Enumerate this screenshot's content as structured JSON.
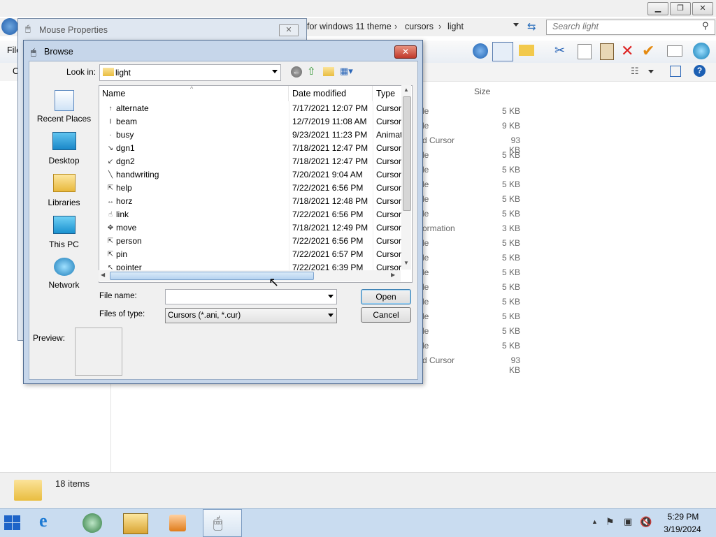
{
  "explorer": {
    "breadcrumb": [
      "for windows 11 theme",
      "cursors",
      "light"
    ],
    "search_placeholder": "Search light",
    "menu_first": "File",
    "cmd_first": "O",
    "size_header": "Size",
    "rows": [
      {
        "type": "le",
        "size": "5 KB"
      },
      {
        "type": "le",
        "size": "9 KB"
      },
      {
        "type": "d Cursor",
        "size": "93 KB"
      },
      {
        "type": "le",
        "size": "5 KB"
      },
      {
        "type": "le",
        "size": "5 KB"
      },
      {
        "type": "le",
        "size": "5 KB"
      },
      {
        "type": "le",
        "size": "5 KB"
      },
      {
        "type": "le",
        "size": "5 KB"
      },
      {
        "type": "ormation",
        "size": "3 KB"
      },
      {
        "type": "le",
        "size": "5 KB"
      },
      {
        "type": "le",
        "size": "5 KB"
      },
      {
        "type": "le",
        "size": "5 KB"
      },
      {
        "type": "le",
        "size": "5 KB"
      },
      {
        "type": "le",
        "size": "5 KB"
      },
      {
        "type": "le",
        "size": "5 KB"
      },
      {
        "type": "le",
        "size": "5 KB"
      },
      {
        "type": "le",
        "size": "5 KB"
      },
      {
        "type": "d Cursor",
        "size": "93 KB"
      }
    ],
    "status_items": "18 items"
  },
  "mouse_props": {
    "title": "Mouse Properties"
  },
  "browse": {
    "title": "Browse",
    "look_in_label": "Look in:",
    "look_in_value": "light",
    "places": [
      "Recent Places",
      "Desktop",
      "Libraries",
      "This PC",
      "Network"
    ],
    "columns": {
      "name": "Name",
      "date": "Date modified",
      "type": "Type"
    },
    "files": [
      {
        "name": "alternate",
        "date": "7/17/2021 12:07 PM",
        "type": "Cursor",
        "icon": "↑"
      },
      {
        "name": "beam",
        "date": "12/7/2019 11:08 AM",
        "type": "Cursor",
        "icon": "I"
      },
      {
        "name": "busy",
        "date": "9/23/2021 11:23 PM",
        "type": "Animated Cursor",
        "icon": "·"
      },
      {
        "name": "dgn1",
        "date": "7/18/2021 12:47 PM",
        "type": "Cursor",
        "icon": "↘"
      },
      {
        "name": "dgn2",
        "date": "7/18/2021 12:47 PM",
        "type": "Cursor",
        "icon": "↙"
      },
      {
        "name": "handwriting",
        "date": "7/20/2021 9:04 AM",
        "type": "Cursor",
        "icon": "╲"
      },
      {
        "name": "help",
        "date": "7/22/2021 6:56 PM",
        "type": "Cursor",
        "icon": "⇱"
      },
      {
        "name": "horz",
        "date": "7/18/2021 12:48 PM",
        "type": "Cursor",
        "icon": "↔"
      },
      {
        "name": "link",
        "date": "7/22/2021 6:56 PM",
        "type": "Cursor",
        "icon": "☝"
      },
      {
        "name": "move",
        "date": "7/18/2021 12:49 PM",
        "type": "Cursor",
        "icon": "✥"
      },
      {
        "name": "person",
        "date": "7/22/2021 6:56 PM",
        "type": "Cursor",
        "icon": "⇱"
      },
      {
        "name": "pin",
        "date": "7/22/2021 6:57 PM",
        "type": "Cursor",
        "icon": "⇱"
      },
      {
        "name": "pointer",
        "date": "7/22/2021 6:39 PM",
        "type": "Cursor",
        "icon": "↖"
      }
    ],
    "file_name_label": "File name:",
    "file_name_value": "",
    "files_of_type_label": "Files of type:",
    "files_of_type_value": "Cursors (*.ani, *.cur)",
    "open_label": "Open",
    "cancel_label": "Cancel",
    "preview_label": "Preview:"
  },
  "taskbar": {
    "time": "5:29 PM",
    "date": "3/19/2024"
  }
}
